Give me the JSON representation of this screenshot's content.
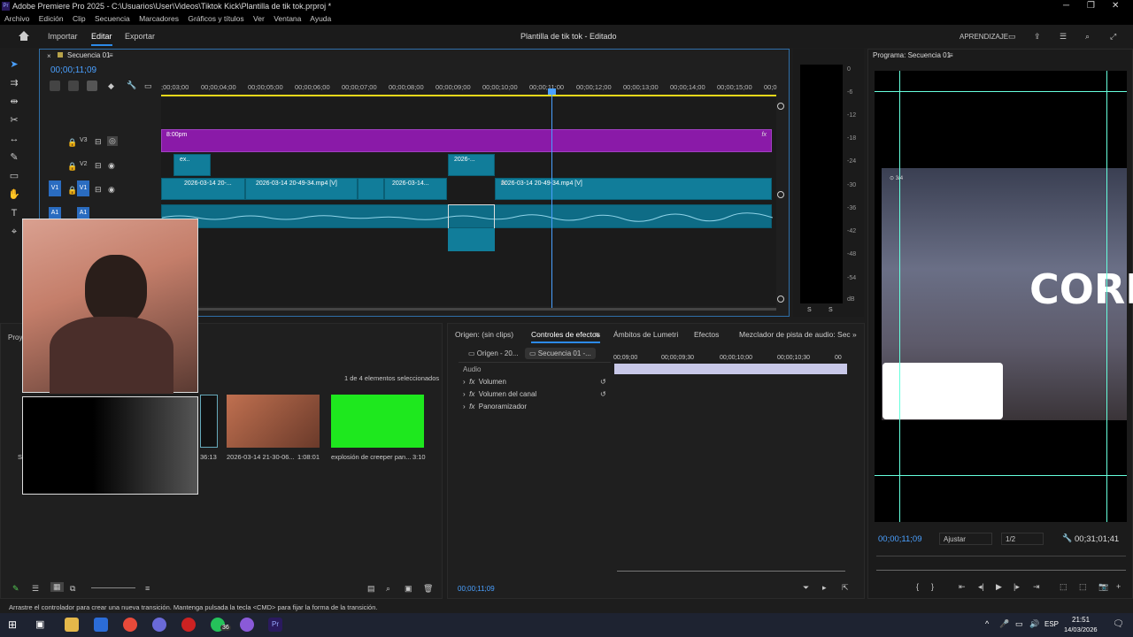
{
  "window": {
    "title": "Adobe Premiere Pro 2025 - C:\\Usuarios\\User\\Videos\\Tiktok Kick\\Plantilla de tik tok.prproj *",
    "app_badge": "Pr"
  },
  "menu": [
    "Archivo",
    "Edición",
    "Clip",
    "Secuencia",
    "Marcadores",
    "Gráficos y títulos",
    "Ver",
    "Ventana",
    "Ayuda"
  ],
  "header": {
    "nav": [
      "Importar",
      "Editar",
      "Exportar"
    ],
    "active": "Editar",
    "project_title": "Plantilla de tik tok - Editado",
    "learn": "APRENDIZAJE"
  },
  "timeline": {
    "sequence_tab": "Secuencia 01",
    "timecode": "00;00;11;09",
    "ruler": [
      ";00;03;00",
      "00;00;04;00",
      "00;00;05;00",
      "00;00;06;00",
      "00;00;07;00",
      "00;00;08;00",
      "00;00;09;00",
      "00;00;10;00",
      "00;00;11;00",
      "00;00;12;00",
      "00;00;13;00",
      "00;00;14;00",
      "00;00;15;00",
      "00;0"
    ],
    "tracks": {
      "v3": "V3",
      "v2": "V2",
      "v1a": "V1",
      "v1b": "V1",
      "a1a": "A1",
      "a1b": "A1"
    },
    "clips": {
      "v3_title": "8:00pm",
      "v2_a": "ex..",
      "v2_b": "2026-...",
      "v1_a": "2026-03-14 20-...",
      "v1_b": "2026-03-14 20-49-34.mp4 [V]",
      "v1_c": "2026-03-14...",
      "v1_d": "2026-03-14 20-49-34.mp4 [V]"
    },
    "fx": "fx"
  },
  "vu_meter": {
    "scale": [
      "0",
      "-6",
      "-12",
      "-18",
      "-24",
      "-30",
      "-36",
      "-42",
      "-48",
      "-54",
      "dB"
    ],
    "solo": [
      "S",
      "S"
    ]
  },
  "program": {
    "title": "Programa: Secuencia 01",
    "timecode": "00;00;11;09",
    "fit": "Ajustar",
    "resolution": "1/2",
    "duration": "00;31;01;41",
    "overlay_text": "CORR",
    "hud_text": "⊙ 3/4"
  },
  "effect_controls": {
    "tabs": [
      "Origen: (sin clips)",
      "Controles de efectos",
      "Ámbitos de Lumetri",
      "Efectos",
      "Mezclador de pista de audio: Secuencia"
    ],
    "active_tab": "Controles de efectos",
    "source": "Origen - 20...",
    "sequence": "Secuencia 01 -...",
    "section": "Audio",
    "rows": [
      "Volumen",
      "Volumen del canal",
      "Panoramizador"
    ],
    "ruler": [
      "00;09;00",
      "00;00;09;30",
      "00;00;10;00",
      "00;00;10;30",
      "00"
    ],
    "timecode": "00;00;11;09"
  },
  "project": {
    "tab": "Proy",
    "selection": "1 de 4 elementos seleccionados",
    "items": [
      {
        "name": "2026-03-14 21-30-06...",
        "duration": "1:08:01"
      },
      {
        "name": "explosión de creeper pan...",
        "duration": "3:10"
      }
    ],
    "partial_duration": "36:13",
    "partial_name": "Se"
  },
  "statusbar": "Arrastre el controlador para crear una nueva transición. Mantenga pulsada la tecla <CMD> para fijar la forma de la transición.",
  "taskbar": {
    "time": "21:51",
    "date": "14/03/2026",
    "lang": "ESP",
    "whatsapp_badge": "36"
  },
  "colors": {
    "accent": "#2c8ae8",
    "clip_video": "#117d9a",
    "clip_title": "#8a1aa8",
    "playhead": "#4aa0ff",
    "green_screen": "#1ee81e"
  }
}
